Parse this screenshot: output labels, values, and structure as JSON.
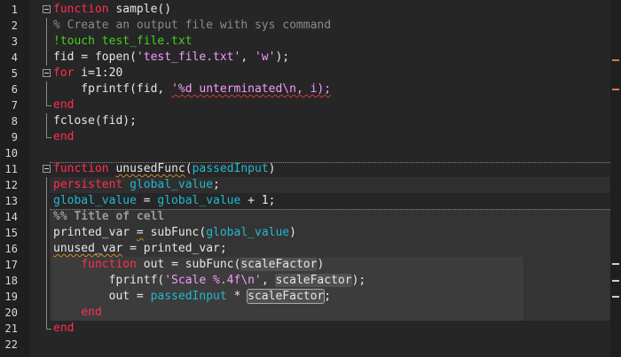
{
  "editor": {
    "lines": [
      {
        "n": "1",
        "parts": [
          {
            "t": "function",
            "c": "kw"
          },
          {
            "t": " sample()",
            "c": ""
          }
        ]
      },
      {
        "n": "2",
        "parts": [
          {
            "t": "% Create an output file with sys command",
            "c": "cm"
          }
        ]
      },
      {
        "n": "3",
        "parts": [
          {
            "t": "!touch test_file.txt",
            "c": "sh"
          }
        ]
      },
      {
        "n": "4",
        "parts": [
          {
            "t": "fid = fopen(",
            "c": ""
          },
          {
            "t": "'test_file.txt'",
            "c": "st"
          },
          {
            "t": ", ",
            "c": ""
          },
          {
            "t": "'w'",
            "c": "st"
          },
          {
            "t": ");",
            "c": ""
          }
        ]
      },
      {
        "n": "5",
        "parts": [
          {
            "t": "for",
            "c": "kw"
          },
          {
            "t": " i=1:20",
            "c": ""
          }
        ]
      },
      {
        "n": "6",
        "parts": [
          {
            "t": "    fprintf(fid, ",
            "c": ""
          },
          {
            "t": "'%d unterminated\\n, i);",
            "c": "st sq"
          }
        ]
      },
      {
        "n": "7",
        "parts": [
          {
            "t": "end",
            "c": "kw"
          }
        ]
      },
      {
        "n": "8",
        "parts": [
          {
            "t": "fclose(fid);",
            "c": ""
          }
        ]
      },
      {
        "n": "9",
        "parts": [
          {
            "t": "end",
            "c": "kw"
          }
        ]
      },
      {
        "n": "10",
        "parts": []
      },
      {
        "n": "11",
        "parts": [
          {
            "t": "function",
            "c": "kw"
          },
          {
            "t": " ",
            "c": ""
          },
          {
            "t": "unusedFunc",
            "c": "sq-o"
          },
          {
            "t": "(",
            "c": ""
          },
          {
            "t": "passedInput",
            "c": "gv"
          },
          {
            "t": ")",
            "c": ""
          }
        ]
      },
      {
        "n": "12",
        "parts": [
          {
            "t": "persistent",
            "c": "kw"
          },
          {
            "t": " ",
            "c": ""
          },
          {
            "t": "global_value",
            "c": "gv"
          },
          {
            "t": ";",
            "c": ""
          }
        ]
      },
      {
        "n": "13",
        "parts": [
          {
            "t": "global_value",
            "c": "gv"
          },
          {
            "t": " = ",
            "c": ""
          },
          {
            "t": "global_value",
            "c": "gv"
          },
          {
            "t": " + 1;",
            "c": ""
          }
        ]
      },
      {
        "n": "14",
        "parts": [
          {
            "t": "%% Title of cell",
            "c": "cell-title"
          }
        ]
      },
      {
        "n": "15",
        "parts": [
          {
            "t": "printed_var ",
            "c": ""
          },
          {
            "t": "=",
            "c": "sq-o"
          },
          {
            "t": " subFunc(",
            "c": ""
          },
          {
            "t": "global_value",
            "c": "gv"
          },
          {
            "t": ")",
            "c": ""
          }
        ]
      },
      {
        "n": "16",
        "parts": [
          {
            "t": "unused_var",
            "c": "sq-o"
          },
          {
            "t": " = printed_var;",
            "c": ""
          }
        ]
      },
      {
        "n": "17",
        "parts": [
          {
            "t": "    ",
            "c": ""
          },
          {
            "t": "function",
            "c": "kw"
          },
          {
            "t": " out = subFunc(",
            "c": ""
          },
          {
            "t": "scaleFactor",
            "c": "hl"
          },
          {
            "t": ")",
            "c": ""
          }
        ]
      },
      {
        "n": "18",
        "parts": [
          {
            "t": "        fprintf(",
            "c": ""
          },
          {
            "t": "'Scale %.4f\\n'",
            "c": "st"
          },
          {
            "t": ", ",
            "c": ""
          },
          {
            "t": "scaleFactor",
            "c": "hl"
          },
          {
            "t": ");",
            "c": ""
          }
        ]
      },
      {
        "n": "19",
        "parts": [
          {
            "t": "        out = ",
            "c": ""
          },
          {
            "t": "passedInput",
            "c": "gv"
          },
          {
            "t": " * ",
            "c": ""
          },
          {
            "t": "scaleFactor",
            "c": "hl cursor-box"
          },
          {
            "t": ";",
            "c": ""
          }
        ]
      },
      {
        "n": "20",
        "parts": [
          {
            "t": "    ",
            "c": ""
          },
          {
            "t": "end",
            "c": "kw"
          }
        ]
      },
      {
        "n": "21",
        "parts": [
          {
            "t": "end",
            "c": "kw"
          }
        ]
      },
      {
        "n": "22",
        "parts": []
      }
    ],
    "folds": [
      "start",
      "bar",
      "bar",
      "bar",
      "start",
      "bar",
      "end",
      "bar",
      "end",
      "",
      "start",
      "bar",
      "bar",
      "bar",
      "bar",
      "bar",
      "bar",
      "bar",
      "bar",
      "bar",
      "end",
      ""
    ],
    "colors": {
      "background": "#262626",
      "keyword": "#ff2f4f",
      "comment": "#8a8a8a",
      "system_command": "#46d01d",
      "string": "#f49cff",
      "variable": "#22b8cf"
    }
  },
  "scrollbar": {
    "markers": [
      "orange",
      "orange",
      "normal",
      "normal",
      "normal"
    ]
  }
}
